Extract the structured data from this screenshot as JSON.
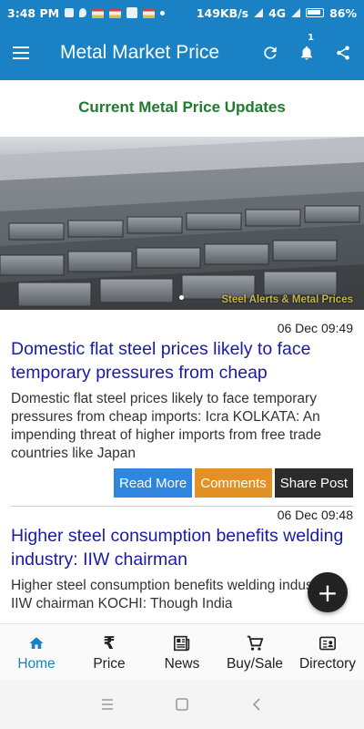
{
  "status_bar": {
    "time": "3:48 PM",
    "speed": "149KB/s",
    "network": "4G",
    "battery": "86%"
  },
  "app_bar": {
    "title": "Metal Market Price",
    "notification_count": "1",
    "color": "#1a82c4"
  },
  "section_title": "Current Metal Price Updates",
  "banner": {
    "caption": "Steel Alerts & Metal Prices"
  },
  "news": [
    {
      "date": "06 Dec 09:49",
      "headline": "Domestic flat steel prices likely to face temporary pressures from cheap",
      "excerpt": "Domestic flat steel prices likely to face temporary pressures from cheap imports: Icra KOLKATA: An impending threat of higher imports from free trade countries like Japan",
      "buttons": {
        "read_more": "Read More",
        "comments": "Comments",
        "share": "Share Post"
      }
    },
    {
      "date": "06 Dec 09:48",
      "headline": "Higher steel consumption benefits welding industry: IIW chairman",
      "excerpt": "Higher steel consumption benefits welding industry: IIW chairman KOCHI: Though India"
    }
  ],
  "fab": {
    "label": "+"
  },
  "bottom_nav": [
    {
      "label": "Home",
      "icon": "home-icon"
    },
    {
      "label": "Price",
      "icon": "rupee-icon"
    },
    {
      "label": "News",
      "icon": "newspaper-icon"
    },
    {
      "label": "Buy/Sale",
      "icon": "cart-icon"
    },
    {
      "label": "Directory",
      "icon": "contact-card-icon"
    }
  ]
}
